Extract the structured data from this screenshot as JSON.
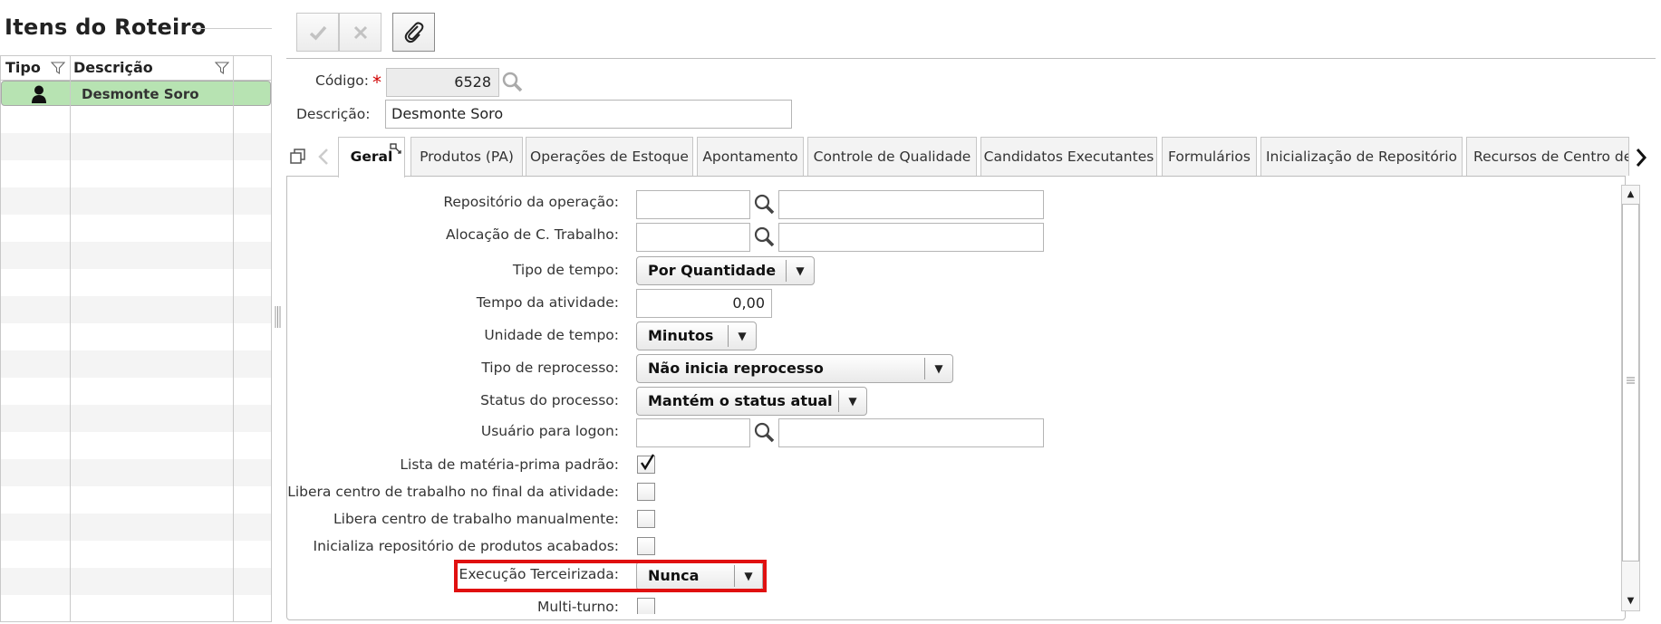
{
  "left_panel": {
    "title": "Itens do Roteiro",
    "columns": [
      "Tipo",
      "Descrição"
    ],
    "rows": [
      {
        "tipo_icon": "person-icon",
        "descricao": "Desmonte Soro",
        "selected": true
      }
    ]
  },
  "toolbar": {
    "confirm_icon": "checkmark-icon",
    "cancel_icon": "close-icon",
    "attach_icon": "paperclip-icon"
  },
  "header": {
    "codigo_label": "Código:",
    "required_mark": "*",
    "codigo_value": "6528",
    "descricao_label": "Descrição:",
    "descricao_value": "Desmonte Soro"
  },
  "tabs": [
    {
      "label": "Geral",
      "active": true
    },
    {
      "label": "Produtos (PA)"
    },
    {
      "label": "Operações de Estoque"
    },
    {
      "label": "Apontamento"
    },
    {
      "label": "Controle de Qualidade"
    },
    {
      "label": "Candidatos Executantes"
    },
    {
      "label": "Formulários"
    },
    {
      "label": "Inicialização de Repositório"
    },
    {
      "label": "Recursos de Centro de"
    }
  ],
  "form": {
    "repositorio_label": "Repositório da operação:",
    "alocacao_label": "Alocação de C. Trabalho:",
    "tipo_tempo_label": "Tipo de tempo:",
    "tipo_tempo_value": "Por Quantidade",
    "tempo_atividade_label": "Tempo da atividade:",
    "tempo_atividade_value": "0,00",
    "unidade_tempo_label": "Unidade de tempo:",
    "unidade_tempo_value": "Minutos",
    "tipo_reprocesso_label": "Tipo de reprocesso:",
    "tipo_reprocesso_value": "Não inicia reprocesso",
    "status_processo_label": "Status do processo:",
    "status_processo_value": "Mantém o status atual",
    "usuario_logon_label": "Usuário para logon:",
    "lista_mp_label": "Lista de matéria-prima padrão:",
    "lista_mp_checked": true,
    "libera_final_label": "Libera centro de trabalho no final da atividade:",
    "libera_final_checked": false,
    "libera_manual_label": "Libera centro de trabalho manualmente:",
    "libera_manual_checked": false,
    "inicializa_repo_label": "Inicializa repositório de produtos acabados:",
    "inicializa_repo_checked": false,
    "execucao_terceirizada_label": "Execução Terceirizada:",
    "execucao_terceirizada_value": "Nunca",
    "multi_turno_label": "Multi-turno:",
    "multi_turno_checked": false
  },
  "colors": {
    "selected_row": "#b7e3b2",
    "highlight_border": "#e01010",
    "required": "#d00000"
  }
}
